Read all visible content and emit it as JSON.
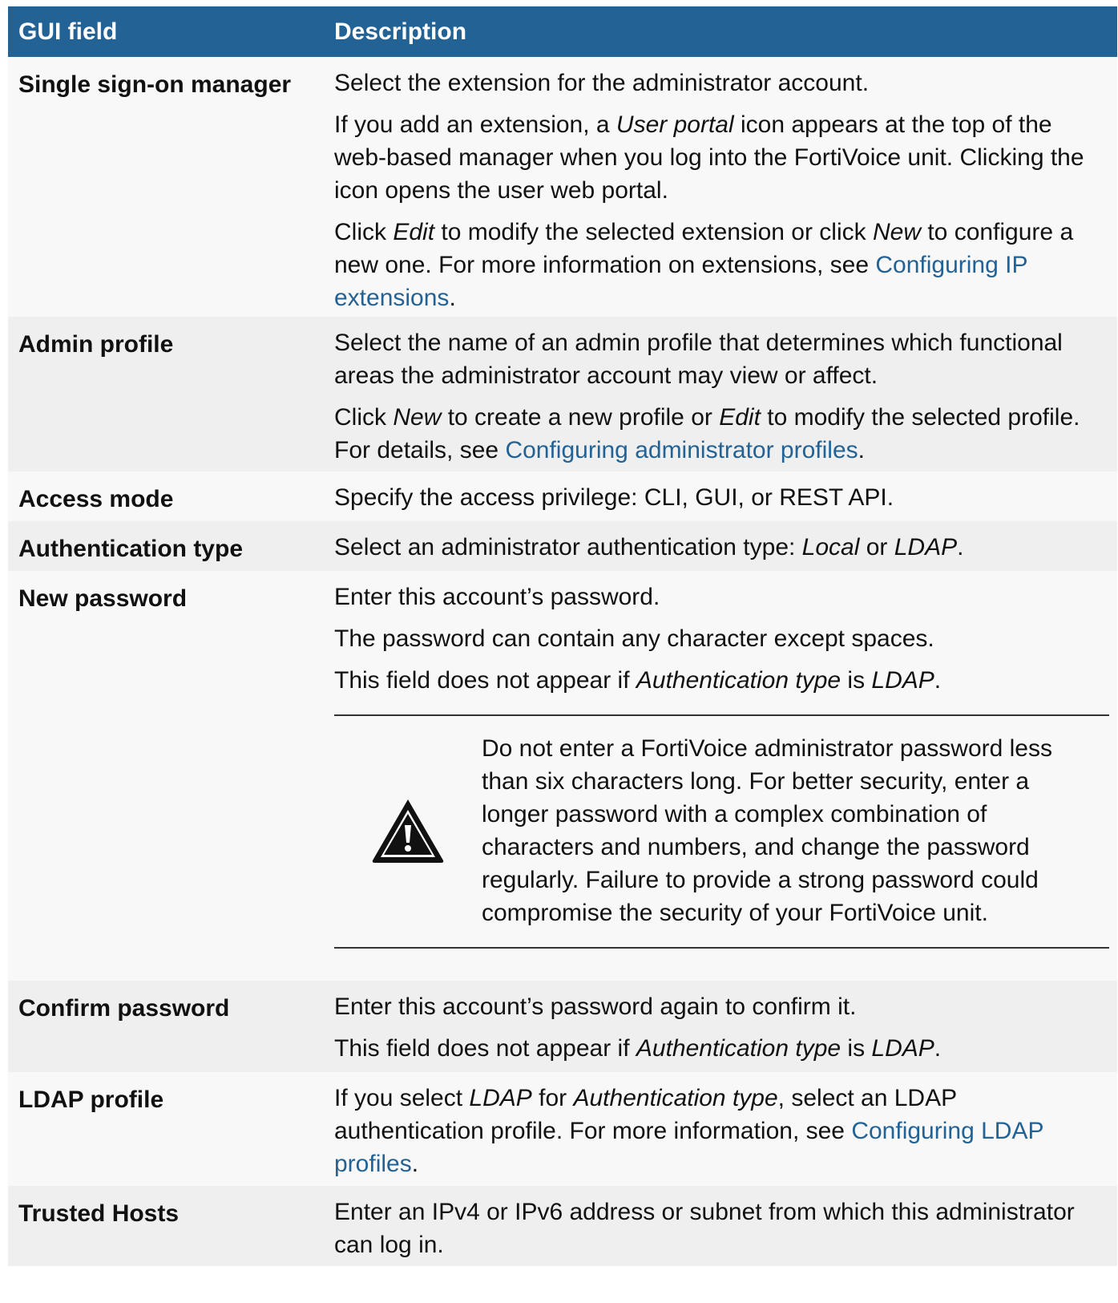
{
  "header": {
    "col1": "GUI field",
    "col2": "Description"
  },
  "rows": {
    "sso": {
      "field": "Single sign-on manager",
      "p1": "Select the extension for the administrator account.",
      "p2a": "If you add an extension, a ",
      "p2b": "User portal",
      "p2c": " icon appears at the top of the web-based manager when you log into the FortiVoice unit. Clicking the icon opens the user web portal.",
      "p3a": "Click ",
      "p3b": "Edit",
      "p3c": " to modify the selected extension or click ",
      "p3d": "New",
      "p3e": " to configure a new one. For more information on extensions, see ",
      "p3link": "Configuring IP extensions",
      "p3f": "."
    },
    "admin_profile": {
      "field": "Admin profile",
      "p1": "Select the name of an admin profile that determines which functional areas the administrator account may view or affect.",
      "p2a": "Click ",
      "p2b": "New",
      "p2c": " to create a new profile or ",
      "p2d": "Edit",
      "p2e": " to modify the selected profile. For details, see ",
      "p2link": "Configuring administrator profiles",
      "p2f": "."
    },
    "access_mode": {
      "field": "Access mode",
      "p1": "Specify the access privilege: CLI, GUI, or REST API."
    },
    "auth_type": {
      "field": "Authentication type",
      "p1a": "Select an administrator authentication type: ",
      "p1b": "Local",
      "p1c": " or ",
      "p1d": "LDAP",
      "p1e": "."
    },
    "new_password": {
      "field": "New password",
      "p1": "Enter this account’s password.",
      "p2": "The password can contain any character except spaces.",
      "p3a": "This field does not appear if ",
      "p3b": "Authentication type",
      "p3c": " is ",
      "p3d": "LDAP",
      "p3e": ".",
      "warning": "Do not enter a FortiVoice administrator password less than six characters long. For better security, enter a longer password with a complex combination of characters and numbers, and change the password regularly. Failure to provide a strong password could compromise the security of your FortiVoice unit."
    },
    "confirm_password": {
      "field": "Confirm password",
      "p1": "Enter this account’s password again to confirm it.",
      "p2a": "This field does not appear if ",
      "p2b": "Authentication type",
      "p2c": " is ",
      "p2d": "LDAP",
      "p2e": "."
    },
    "ldap_profile": {
      "field": "LDAP profile",
      "p1a": "If you select ",
      "p1b": "LDAP",
      "p1c": " for ",
      "p1d": "Authentication type",
      "p1e": ", select an LDAP authentication profile. For more information, see ",
      "p1link": "Configuring LDAP profiles",
      "p1f": "."
    },
    "trusted_hosts": {
      "field": "Trusted Hosts",
      "p1": "Enter an IPv4 or IPv6 address or subnet from which this administrator can log in."
    }
  },
  "icons": {
    "warning": "warning-triangle-icon"
  },
  "colors": {
    "header_bg": "#236295",
    "link": "#236295"
  }
}
